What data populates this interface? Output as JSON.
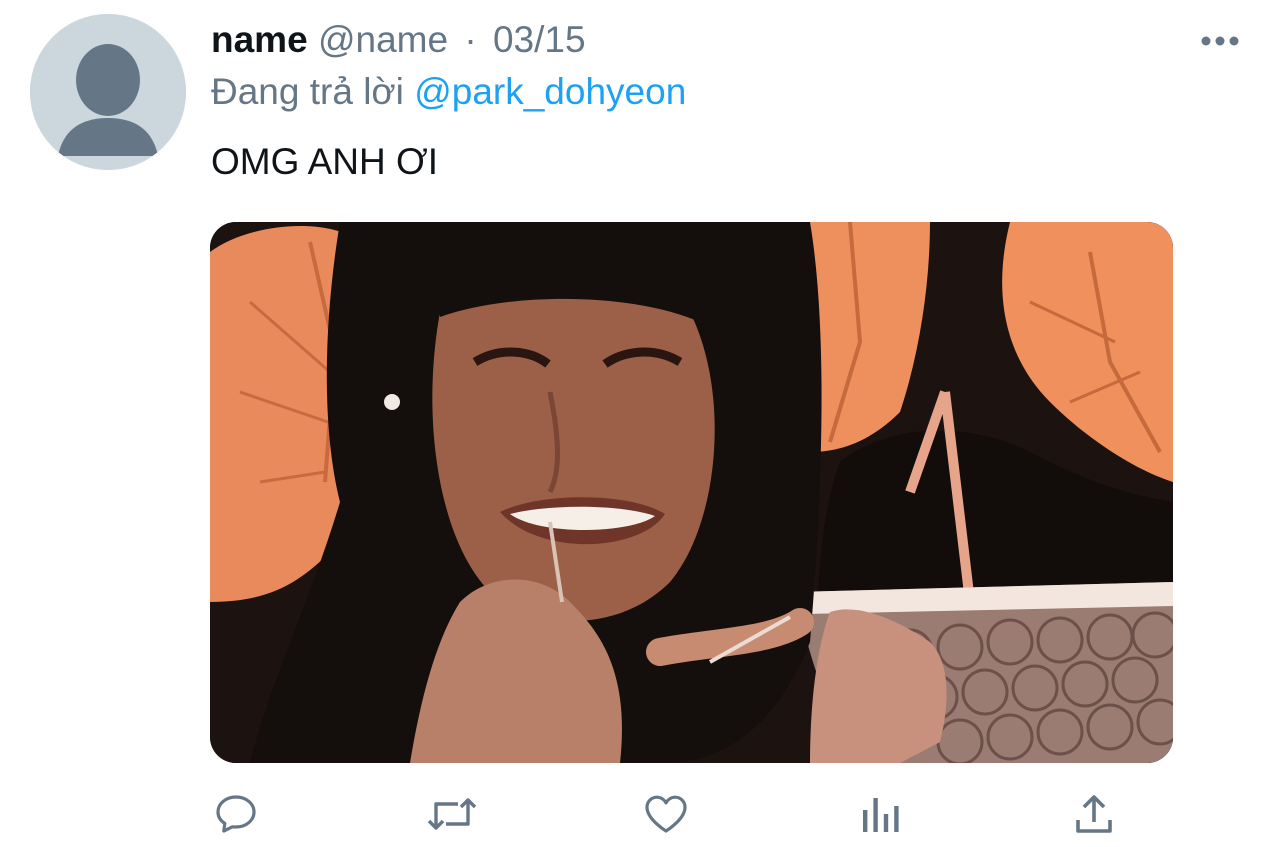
{
  "tweet": {
    "display_name": "name",
    "handle": "@name",
    "separator": "·",
    "date": "03/15",
    "reply_prefix": "Đang trả lời",
    "reply_to": "@park_dohyeon",
    "text": "OMG ANH ƠI"
  },
  "icons": {
    "more": "more-horizontal-icon",
    "reply": "comment-bubble-icon",
    "retweet": "retweet-arrows-icon",
    "like": "heart-outline-icon",
    "analytics": "bar-chart-icon",
    "share": "share-upload-icon"
  },
  "colors": {
    "text_primary": "#0f1419",
    "text_secondary": "#657786",
    "link": "#1da1f2",
    "icon": "#657786",
    "avatar_bg": "#ccd6dd",
    "avatar_fg": "#657786"
  }
}
